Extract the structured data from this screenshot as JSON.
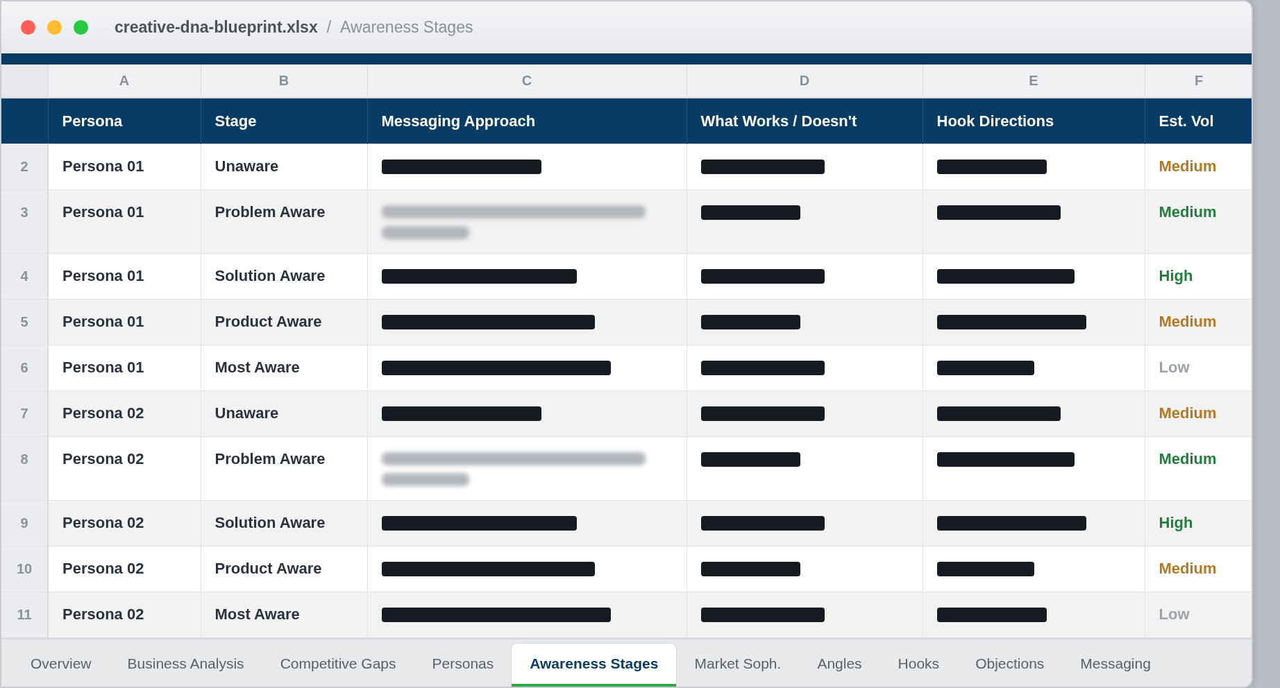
{
  "window": {
    "title": "creative-dna-blueprint.xlsx",
    "separator": "/",
    "sheet_name": "Awareness Stages"
  },
  "sheet": {
    "column_letters": [
      "A",
      "B",
      "C",
      "D",
      "E",
      "F"
    ],
    "columns": [
      "Persona",
      "Stage",
      "Messaging Approach",
      "What Works / Doesn't",
      "Hook Directions",
      "Est. Vol"
    ],
    "rows": [
      {
        "number": "2",
        "persona": "Persona 01",
        "stage": "Unaware",
        "messaging_approach": {
          "kind": "redacted"
        },
        "what_works": {
          "kind": "redacted"
        },
        "hook_directions": {
          "kind": "redacted"
        },
        "est_vol": {
          "text": "Medium",
          "color": "#b8781e"
        }
      },
      {
        "number": "3",
        "persona": "Persona 01",
        "stage": "Problem Aware",
        "messaging_approach": {
          "kind": "blurred"
        },
        "what_works": {
          "kind": "redacted"
        },
        "hook_directions": {
          "kind": "redacted"
        },
        "est_vol": {
          "text": "Medium",
          "color": "#1f7f3b"
        }
      },
      {
        "number": "4",
        "persona": "Persona 01",
        "stage": "Solution Aware",
        "messaging_approach": {
          "kind": "redacted"
        },
        "what_works": {
          "kind": "redacted"
        },
        "hook_directions": {
          "kind": "redacted"
        },
        "est_vol": {
          "text": "High",
          "color": "#1f7f3b"
        }
      },
      {
        "number": "5",
        "persona": "Persona 01",
        "stage": "Product Aware",
        "messaging_approach": {
          "kind": "redacted"
        },
        "what_works": {
          "kind": "redacted"
        },
        "hook_directions": {
          "kind": "redacted"
        },
        "est_vol": {
          "text": "Medium",
          "color": "#b8781e"
        }
      },
      {
        "number": "6",
        "persona": "Persona 01",
        "stage": "Most Aware",
        "messaging_approach": {
          "kind": "redacted"
        },
        "what_works": {
          "kind": "redacted"
        },
        "hook_directions": {
          "kind": "redacted"
        },
        "est_vol": {
          "text": "Low",
          "color": "#9ba2ab"
        }
      },
      {
        "number": "7",
        "persona": "Persona 02",
        "stage": "Unaware",
        "messaging_approach": {
          "kind": "redacted"
        },
        "what_works": {
          "kind": "redacted"
        },
        "hook_directions": {
          "kind": "redacted"
        },
        "est_vol": {
          "text": "Medium",
          "color": "#b8781e"
        }
      },
      {
        "number": "8",
        "persona": "Persona 02",
        "stage": "Problem Aware",
        "messaging_approach": {
          "kind": "blurred"
        },
        "what_works": {
          "kind": "redacted"
        },
        "hook_directions": {
          "kind": "redacted"
        },
        "est_vol": {
          "text": "Medium",
          "color": "#1f7f3b"
        }
      },
      {
        "number": "9",
        "persona": "Persona 02",
        "stage": "Solution Aware",
        "messaging_approach": {
          "kind": "redacted"
        },
        "what_works": {
          "kind": "redacted"
        },
        "hook_directions": {
          "kind": "redacted"
        },
        "est_vol": {
          "text": "High",
          "color": "#1f7f3b"
        }
      },
      {
        "number": "10",
        "persona": "Persona 02",
        "stage": "Product Aware",
        "messaging_approach": {
          "kind": "redacted"
        },
        "what_works": {
          "kind": "redacted"
        },
        "hook_directions": {
          "kind": "redacted"
        },
        "est_vol": {
          "text": "Medium",
          "color": "#b8781e"
        }
      },
      {
        "number": "11",
        "persona": "Persona 02",
        "stage": "Most Aware",
        "messaging_approach": {
          "kind": "redacted"
        },
        "what_works": {
          "kind": "redacted"
        },
        "hook_directions": {
          "kind": "redacted"
        },
        "est_vol": {
          "text": "Low",
          "color": "#9ba2ab"
        }
      }
    ]
  },
  "sheet_tabs": [
    {
      "label": "Overview",
      "selected": false
    },
    {
      "label": "Business Analysis",
      "selected": false
    },
    {
      "label": "Competitive Gaps",
      "selected": false
    },
    {
      "label": "Personas",
      "selected": false
    },
    {
      "label": "Awareness Stages",
      "selected": true
    },
    {
      "label": "Market Soph.",
      "selected": false
    },
    {
      "label": "Angles",
      "selected": false
    },
    {
      "label": "Hooks",
      "selected": false
    },
    {
      "label": "Objections",
      "selected": false
    },
    {
      "label": "Messaging",
      "selected": false
    }
  ]
}
